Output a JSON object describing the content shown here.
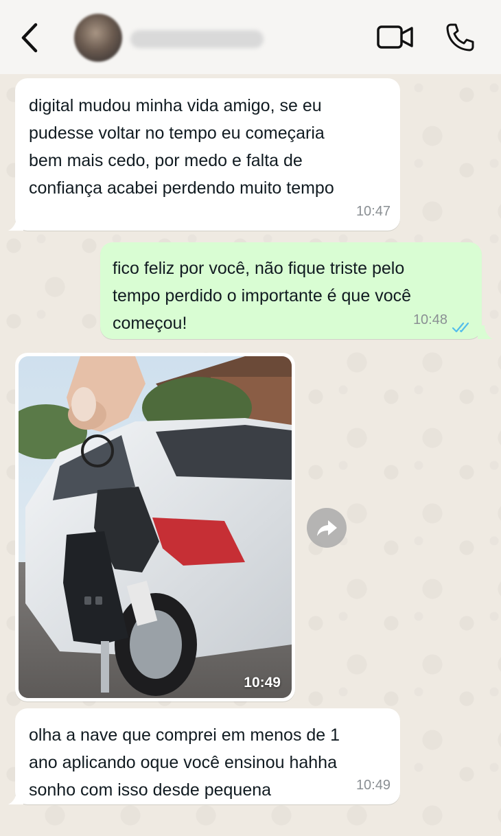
{
  "header": {
    "back_icon": "chevron-left-icon",
    "contact_name": "",
    "video_icon": "video-camera-icon",
    "call_icon": "phone-icon"
  },
  "messages": [
    {
      "type": "text",
      "direction": "incoming",
      "text": "digital mudou minha vida amigo, se eu\npudesse voltar no tempo eu começaria\nbem mais cedo, por medo e falta de\nconfiança acabei perdendo muito tempo",
      "time": "10:47"
    },
    {
      "type": "text",
      "direction": "outgoing",
      "text": "fico feliz por você, não fique triste pelo\ntempo perdido o importante é que você\ncomeçou!",
      "time": "10:48",
      "status_icon": "double-check-read-icon"
    },
    {
      "type": "image",
      "direction": "incoming",
      "image_description": "hand holding car keys in front of a white hatchback",
      "time": "10:49",
      "forward_icon": "forward-arrow-icon"
    },
    {
      "type": "text",
      "direction": "incoming",
      "text": "olha a nave que comprei em menos de 1\nano aplicando oque você ensinou hahha\nsonho com isso desde pequena",
      "time": "10:49"
    }
  ],
  "colors": {
    "header_bg": "#f6f5f3",
    "chat_bg": "#efeae2",
    "incoming_bubble": "#ffffff",
    "outgoing_bubble": "#d9fdd3",
    "read_ticks": "#53bdeb"
  }
}
